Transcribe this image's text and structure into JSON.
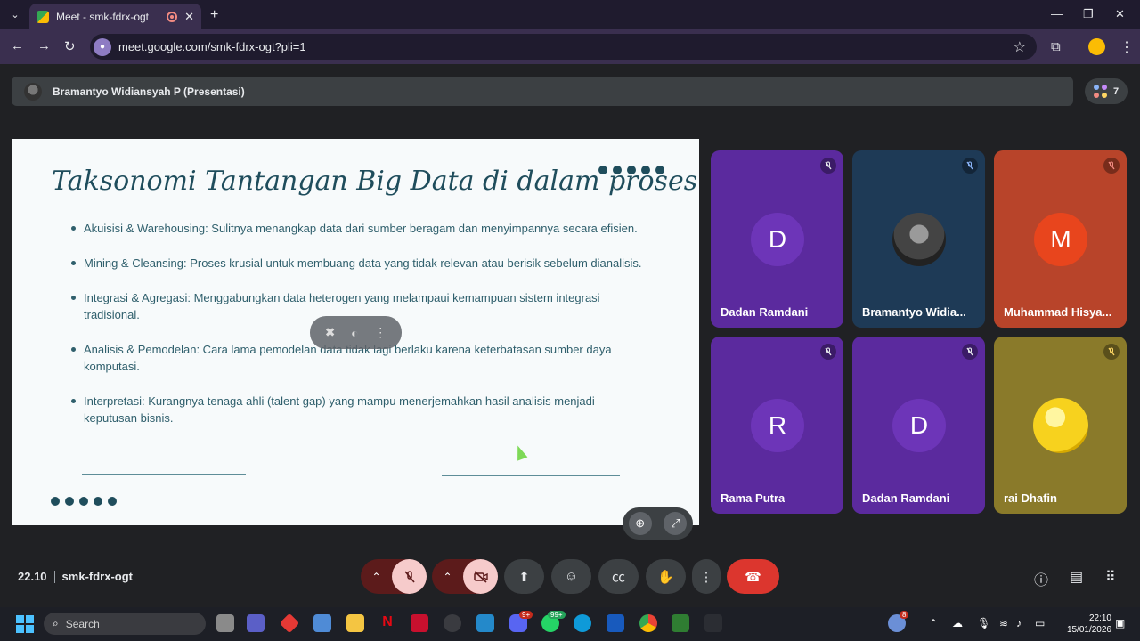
{
  "browser": {
    "tab_title": "Meet - smk-fdrx-ogt",
    "new_tab_symbol": "+",
    "url": "meet.google.com/smk-fdrx-ogt?pli=1"
  },
  "presenter_bar": {
    "name": "Bramantyo Widiansyah P (Presentasi)",
    "people_count": "7"
  },
  "slide": {
    "title": "Taksonomi Tantangan Big Data di dalam proses",
    "bullets": [
      "Akuisisi & Warehousing: Sulitnya menangkap data dari sumber beragam dan menyimpannya secara efisien.",
      "Mining & Cleansing: Proses krusial untuk membuang data yang tidak relevan atau berisik sebelum dianalisis.",
      "Integrasi & Agregasi: Menggabungkan data heterogen yang melampaui kemampuan sistem integrasi tradisional.",
      "Analisis & Pemodelan: Cara lama pemodelan data tidak lagi berlaku karena keterbatasan sumber daya komputasi.",
      "Interpretasi: Kurangnya tenaga ahli (talent gap) yang mampu menerjemahkan hasil analisis menjadi keputusan bisnis."
    ]
  },
  "participants": [
    {
      "name": "Dadan Ramdani",
      "initial": "D",
      "color": "#5b2a9e",
      "avatar_color": "#6d35b8"
    },
    {
      "name": "Bramantyo Widia...",
      "initial": "",
      "color": "#1e3a56",
      "avatar_color": "#444"
    },
    {
      "name": "Muhammad Hisya...",
      "initial": "M",
      "color": "#b8442a",
      "avatar_color": "#e8451d"
    },
    {
      "name": "Rama Putra",
      "initial": "R",
      "color": "#5b2a9e",
      "avatar_color": "#6d35b8"
    },
    {
      "name": "Dadan Ramdani",
      "initial": "D",
      "color": "#5b2a9e",
      "avatar_color": "#6d35b8"
    },
    {
      "name": "rai Dhafin",
      "initial": "",
      "color": "#8a7a2a",
      "avatar_color": "#f7d21e"
    }
  ],
  "meeting": {
    "time": "22.10",
    "code": "smk-fdrx-ogt"
  },
  "colors": {
    "end_call": "#dc362e",
    "mic_off_bg": "#f6cbcb",
    "slide_text": "#2f5f6c"
  },
  "taskbar": {
    "search_label": "Search",
    "weather_badge": "8",
    "discord_badge": "9+",
    "whatsapp_badge": "99+",
    "time": "22:10",
    "date": "15/01/2026"
  }
}
